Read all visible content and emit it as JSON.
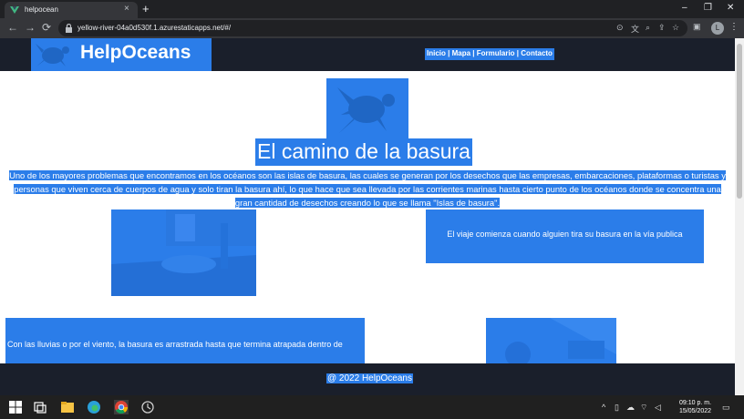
{
  "browser": {
    "tab_title": "helpocean",
    "tab_close": "×",
    "new_tab": "+",
    "window_controls": {
      "minimize": "–",
      "restore": "❐",
      "close": "✕"
    },
    "nav": {
      "back": "←",
      "forward": "→",
      "reload": "⟳"
    },
    "url": "yellow-river-04a0d530f.1.azurestaticapps.net/#/",
    "profile_initial": "L",
    "menu": "⋮",
    "toolbar_icons": [
      "google-lens-icon",
      "translate-icon",
      "zoom-icon",
      "share-icon",
      "bookmark-star-icon",
      "sidebar-icon"
    ],
    "colors": {
      "tabbar": "#202124",
      "toolbar": "#35363a"
    }
  },
  "site": {
    "logo_text": "HelpOceans",
    "nav": [
      {
        "label": "Inicio"
      },
      {
        "label": "Mapa"
      },
      {
        "label": "Formulario"
      },
      {
        "label": "Contacto"
      }
    ],
    "nav_separator": "|",
    "title": "El camino de la basura",
    "intro_line1": "Uno de los mayores problemas que encontramos en los océanos son las islas de basura, las cuales se generan por los desechos que las empresas, embarcaciones, plataformas o turistas y",
    "intro_line2": "personas que viven cerca de cuerpos de agua y solo tiran la basura ahí, lo que hace que sea llevada por las corrientes marinas hasta cierto punto de los océanos donde se concentra una",
    "intro_line3": "gran cantidad de desechos creando lo que se llama \"Islas de basura\".",
    "step1_text": "El viaje comienza cuando alguien tira su basura en la vía publica",
    "step2_text": "Con las lluvias o por el viento, la basura es arrastrada hasta que termina atrapada dentro de",
    "footer": "@ 2022 HelpOceans",
    "colors": {
      "header": "#1a1f2b",
      "highlight": "#2b7de9",
      "text": "#ffffff"
    }
  },
  "taskbar": {
    "icons": [
      "windows-start-icon",
      "search-icon",
      "task-view-icon",
      "file-explorer-icon",
      "edge-icon",
      "chrome-icon",
      "app-icon"
    ],
    "time": "09:10 p. m.",
    "date": "15/05/2022"
  }
}
